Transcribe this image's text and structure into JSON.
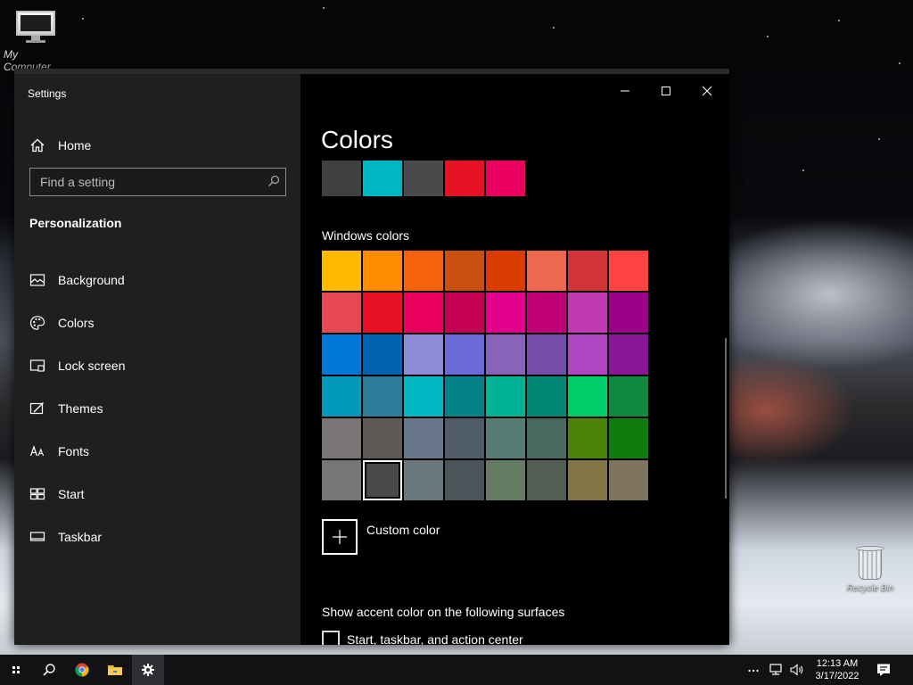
{
  "desktop": {
    "icons": {
      "my_computer": "My Computer",
      "recycle_bin": "Recycle Bin"
    }
  },
  "window": {
    "title": "Settings",
    "sidebar": {
      "home_label": "Home",
      "search_placeholder": "Find a setting",
      "section_title": "Personalization",
      "items": [
        {
          "label": "Background",
          "icon": "picture-icon"
        },
        {
          "label": "Colors",
          "icon": "palette-icon"
        },
        {
          "label": "Lock screen",
          "icon": "lock-screen-icon"
        },
        {
          "label": "Themes",
          "icon": "brush-icon"
        },
        {
          "label": "Fonts",
          "icon": "font-icon"
        },
        {
          "label": "Start",
          "icon": "start-grid-icon"
        },
        {
          "label": "Taskbar",
          "icon": "taskbar-icon"
        }
      ],
      "selected_item": "Colors"
    },
    "main": {
      "title": "Colors",
      "recent_colors": [
        "#404040",
        "#00b7c3",
        "#4a4a4a",
        "#e81123",
        "#ea005e"
      ],
      "windows_colors_label": "Windows colors",
      "windows_colors": [
        [
          "#ffb900",
          "#ff8c00",
          "#f7630c",
          "#ca5010",
          "#da3b01",
          "#ef6950",
          "#d13438",
          "#ff4343"
        ],
        [
          "#e74856",
          "#e81123",
          "#ea005e",
          "#c30052",
          "#e3008c",
          "#bf0077",
          "#c239b3",
          "#9a0089"
        ],
        [
          "#0078d7",
          "#0063b1",
          "#8e8cd8",
          "#6b69d6",
          "#8764b8",
          "#744da9",
          "#b146c2",
          "#881798"
        ],
        [
          "#0099bc",
          "#2d7d9a",
          "#00b7c3",
          "#038387",
          "#00b294",
          "#018574",
          "#00cc6a",
          "#10893e"
        ],
        [
          "#7a7574",
          "#5d5a58",
          "#68768a",
          "#515c6b",
          "#567c73",
          "#486860",
          "#498205",
          "#107c10"
        ],
        [
          "#767676",
          "#4c4a48",
          "#69797e",
          "#4a5459",
          "#647c64",
          "#525e54",
          "#847545",
          "#7e735f"
        ]
      ],
      "selected_color": "#4c4a48",
      "custom_color_label": "Custom color",
      "accent_surfaces_label": "Show accent color on the following surfaces",
      "checkbox_label": "Start, taskbar, and action center"
    },
    "controls": {
      "minimize": "minimize-icon",
      "maximize": "maximize-icon",
      "close": "close-icon"
    }
  },
  "taskbar": {
    "clock_time": "12:13 AM",
    "clock_date": "3/17/2022",
    "apps": [
      "start-icon",
      "search-icon",
      "chrome-icon",
      "file-explorer-icon",
      "settings-icon"
    ],
    "active_app": "settings-icon"
  }
}
